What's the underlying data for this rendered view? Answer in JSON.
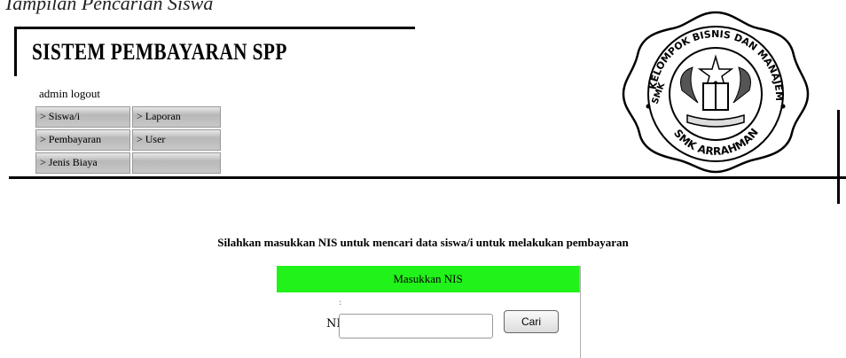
{
  "caption": "Tampilan Pencarian Siswa",
  "app_title": "SISTEM PEMBAYARAN SPP",
  "user": {
    "name": "admin",
    "logout_label": "logout"
  },
  "menu": {
    "items": [
      "> Siswa/i",
      "> Laporan",
      "> Pembayaran",
      "> User",
      "> Jenis Biaya",
      ""
    ]
  },
  "logo": {
    "top_text": "KELOMPOK BISNIS DAN MANAJEMEN",
    "left_text": "SMK",
    "bottom_text": "SMK ARRAHMAN"
  },
  "main": {
    "instruction": "Silahkan masukkan NIS untuk mencari data siswa/i untuk melakukan pembayaran",
    "form": {
      "header": "Masukkan NIS",
      "label": "NIS",
      "colon": ":",
      "input_value": "",
      "input_placeholder": "",
      "search_button": "Cari"
    }
  },
  "colors": {
    "header_green": "#21f21a"
  }
}
